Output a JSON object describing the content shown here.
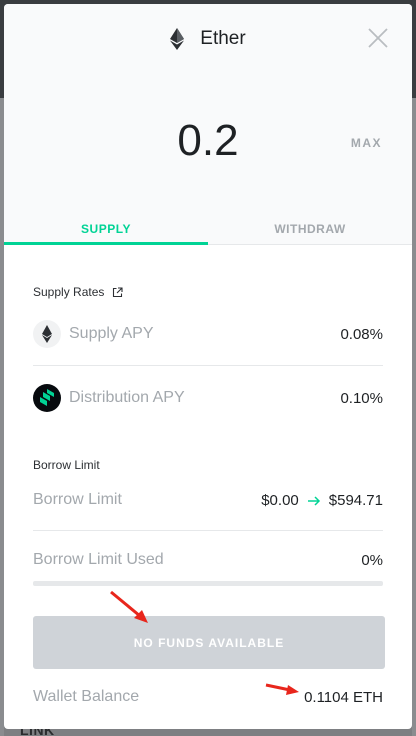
{
  "backdrop": {
    "link_text": "LINK"
  },
  "modal": {
    "title": "Ether",
    "amount": "0.2",
    "max_label": "MAX",
    "tabs": [
      {
        "label": "SUPPLY",
        "active": true
      },
      {
        "label": "WITHDRAW",
        "active": false
      }
    ]
  },
  "supply_rates": {
    "heading": "Supply Rates",
    "rows": [
      {
        "label": "Supply APY",
        "value": "0.08%",
        "icon": "eth-icon"
      },
      {
        "label": "Distribution APY",
        "value": "0.10%",
        "icon": "comp-icon"
      }
    ]
  },
  "borrow_limit": {
    "heading": "Borrow Limit",
    "limit_label": "Borrow Limit",
    "limit_from": "$0.00",
    "limit_to": "$594.71",
    "used_label": "Borrow Limit Used",
    "used_value": "0%"
  },
  "action": {
    "label": "NO FUNDS AVAILABLE"
  },
  "wallet": {
    "label": "Wallet Balance",
    "value": "0.1104 ETH"
  },
  "colors": {
    "accent": "#00d395",
    "button_disabled": "#cfd3d8",
    "annotation_arrow": "#e8261c"
  }
}
